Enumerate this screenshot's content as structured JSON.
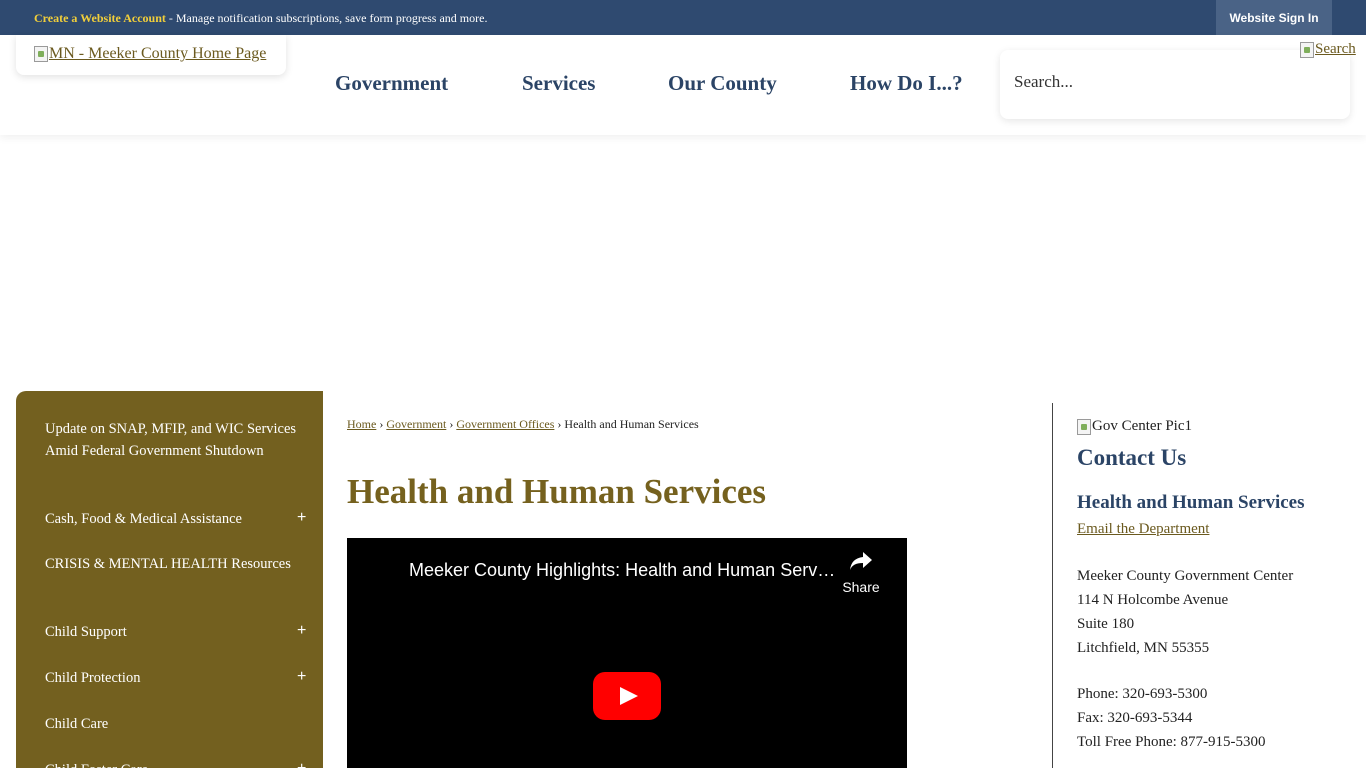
{
  "topbar": {
    "create_account_link": "Create a Website Account",
    "message": " - Manage notification subscriptions, save form progress and more.",
    "signin_label": "Website Sign In"
  },
  "header": {
    "logo_alt": "MN - Meeker County Home Page",
    "nav": [
      "Government",
      "Services",
      "Our County",
      "How Do I...?"
    ],
    "search_placeholder": "Search...",
    "search_button_alt": "Search"
  },
  "sidebar": {
    "items": [
      {
        "label": "Update on SNAP, MFIP, and WIC Services Amid Federal Government Shutdown",
        "expandable": false
      },
      {
        "label": "Cash, Food & Medical Assistance",
        "expandable": true
      },
      {
        "label": "CRISIS & MENTAL HEALTH Resources",
        "expandable": false
      },
      {
        "label": "Child Support",
        "expandable": true
      },
      {
        "label": "Child Protection",
        "expandable": true
      },
      {
        "label": "Child Care",
        "expandable": false
      },
      {
        "label": "Child Foster Care",
        "expandable": true
      }
    ],
    "expand_symbol": "+"
  },
  "breadcrumb": {
    "items": [
      "Home",
      "Government",
      "Government Offices"
    ],
    "current": "Health and Human Services",
    "separator": "›"
  },
  "main": {
    "title": "Health and Human Services",
    "video": {
      "title": "Meeker County Highlights: Health and Human Services",
      "share_label": "Share"
    }
  },
  "contact": {
    "image_alt": "Gov Center Pic1",
    "heading": "Contact Us",
    "department": "Health and Human Services",
    "email_link": "Email the Department",
    "address_lines": [
      "Meeker County Government Center",
      "114 N Holcombe Avenue",
      "Suite 180",
      "Litchfield, MN  55355"
    ],
    "phone": "Phone: 320-693-5300",
    "fax": "Fax: 320-693-5344",
    "toll_free": "Toll Free Phone: 877-915-5300"
  },
  "colors": {
    "topbar": "#2f4a70",
    "accent_gold": "#f2cf3a",
    "sidebar": "#73601f",
    "title": "#75611e",
    "nav_text": "#2b4466"
  }
}
